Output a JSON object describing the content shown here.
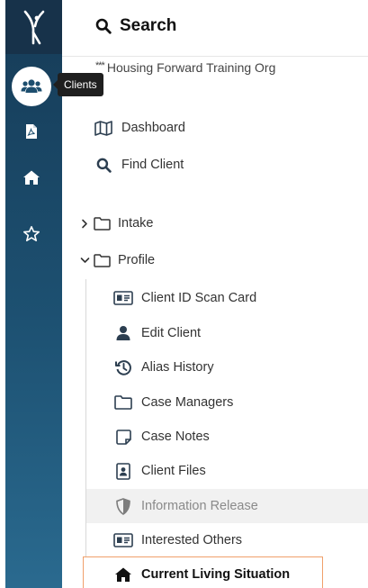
{
  "search": {
    "title": "Search"
  },
  "tooltip": {
    "label": "Clients"
  },
  "org": {
    "stars": "***",
    "name": "Housing Forward Training Org"
  },
  "nav": {
    "dashboard": "Dashboard",
    "find_client": "Find Client",
    "intake": "Intake",
    "profile": "Profile"
  },
  "profile_items": [
    {
      "label": "Client ID Scan Card",
      "icon": "id-card-icon"
    },
    {
      "label": "Edit Client",
      "icon": "user-icon"
    },
    {
      "label": "Alias History",
      "icon": "history-icon"
    },
    {
      "label": "Case Managers",
      "icon": "folder-icon"
    },
    {
      "label": "Case Notes",
      "icon": "note-icon"
    },
    {
      "label": "Client Files",
      "icon": "file-user-icon"
    },
    {
      "label": "Information Release",
      "icon": "shield-icon"
    },
    {
      "label": "Interested Others",
      "icon": "id-card-icon"
    },
    {
      "label": "Current Living Situation",
      "icon": "home-icon"
    }
  ],
  "colors": {
    "rail_top": "#163b57",
    "rail_bottom": "#2a6a8f",
    "active_border": "#f0a06b"
  }
}
